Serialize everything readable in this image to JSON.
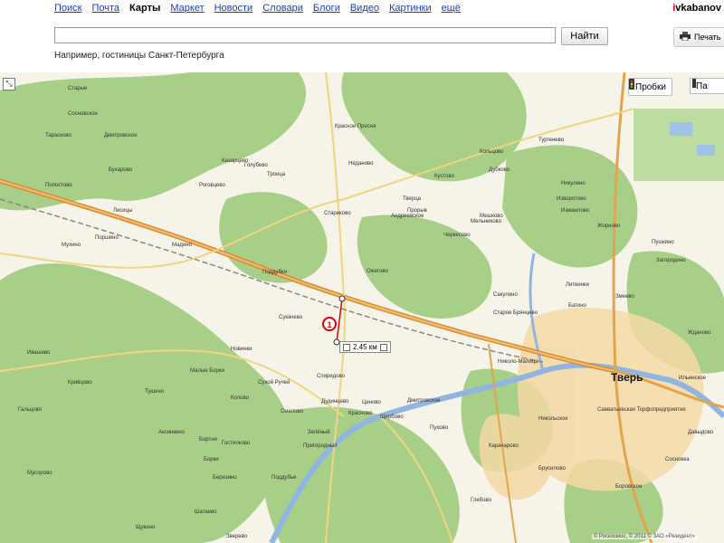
{
  "header": {
    "nav": [
      "Поиск",
      "Почта",
      "Карты",
      "Маркет",
      "Новости",
      "Словари",
      "Блоги",
      "Видео",
      "Картинки",
      "ещё"
    ],
    "active_nav": "Карты",
    "user_first": "i",
    "user_rest": "vkabanov",
    "search_value": "",
    "search_button": "Найти",
    "example": "Например, гостиницы Санкт-Петербурга",
    "print_label": "Печать"
  },
  "map": {
    "traffic_label": "Пробки",
    "layer_label": "Па",
    "ruler_text": "2,45 км",
    "marker_number": "1",
    "city_label": "Тверь",
    "copyright": "© Роскосмос, © 2011 © ЗАО «Резидент»",
    "places": [
      "Старые",
      "Сосновское",
      "Дмитровское",
      "Тарасково",
      "Бухарово",
      "Попостово",
      "Лисицы",
      "Поршино",
      "Мухино",
      "Мадино",
      "Роговцево",
      "Голубево",
      "Казарцево",
      "Троица",
      "Поддубки",
      "Ожегово",
      "Красное Пресня",
      "Неданово",
      "Тверца",
      "Кустово",
      "Дубково",
      "Кольцово",
      "Тургенево",
      "Прорыв",
      "Стариково",
      "Андреевское",
      "Мешково",
      "Черкесово",
      "Мельниково",
      "Измаилово",
      "Никулино",
      "Изворотово",
      "Жорново",
      "Пушкино",
      "Загородино",
      "Сакулино",
      "Старое Брянцево",
      "Батино",
      "Литвинки",
      "Змеево",
      "Жданово",
      "Николо-Малица",
      "Спиридово",
      "Колово",
      "Сукачево",
      "Новинки",
      "Малые Борки",
      "Сухой Ручей",
      "Тушино",
      "Кривцово",
      "Ивашево",
      "Аксинкино",
      "Бортни",
      "Дудинцево",
      "Смелово",
      "Красново",
      "Ценово",
      "Дмитровское",
      "Щербово",
      "Пухово",
      "Савватьевская Торфопредприятие",
      "Никольское",
      "Брусилово",
      "Боровское",
      "Давыдово",
      "Зелёный",
      "Пригородный",
      "Поддубье",
      "Карачарово",
      "Гостилково",
      "Борки",
      "Шатаево",
      "Зверево",
      "Березино",
      "Щукино",
      "Гальцово",
      "Мусорово",
      "Сосновка",
      "Ильинское",
      "Глебово",
      "Богородское"
    ]
  }
}
